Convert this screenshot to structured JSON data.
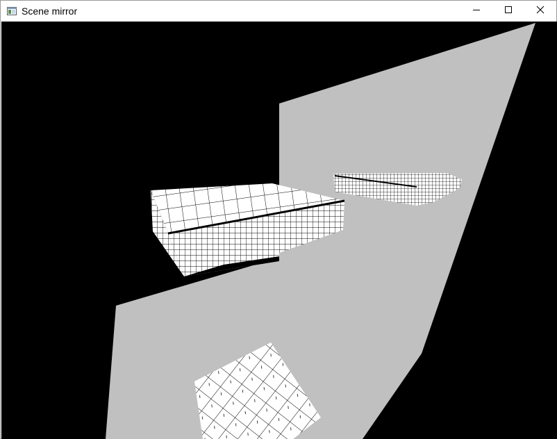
{
  "window": {
    "title": "Scene mirror",
    "app_icon": "window-app-icon",
    "controls": {
      "minimize_icon": "minimize-icon",
      "maximize_icon": "maximize-icon",
      "close_icon": "close-icon"
    }
  },
  "scene": {
    "background_color": "#000000",
    "mirror_color": "#c0c0c0",
    "box_color": "#ffffff",
    "grid_color": "#000000"
  }
}
